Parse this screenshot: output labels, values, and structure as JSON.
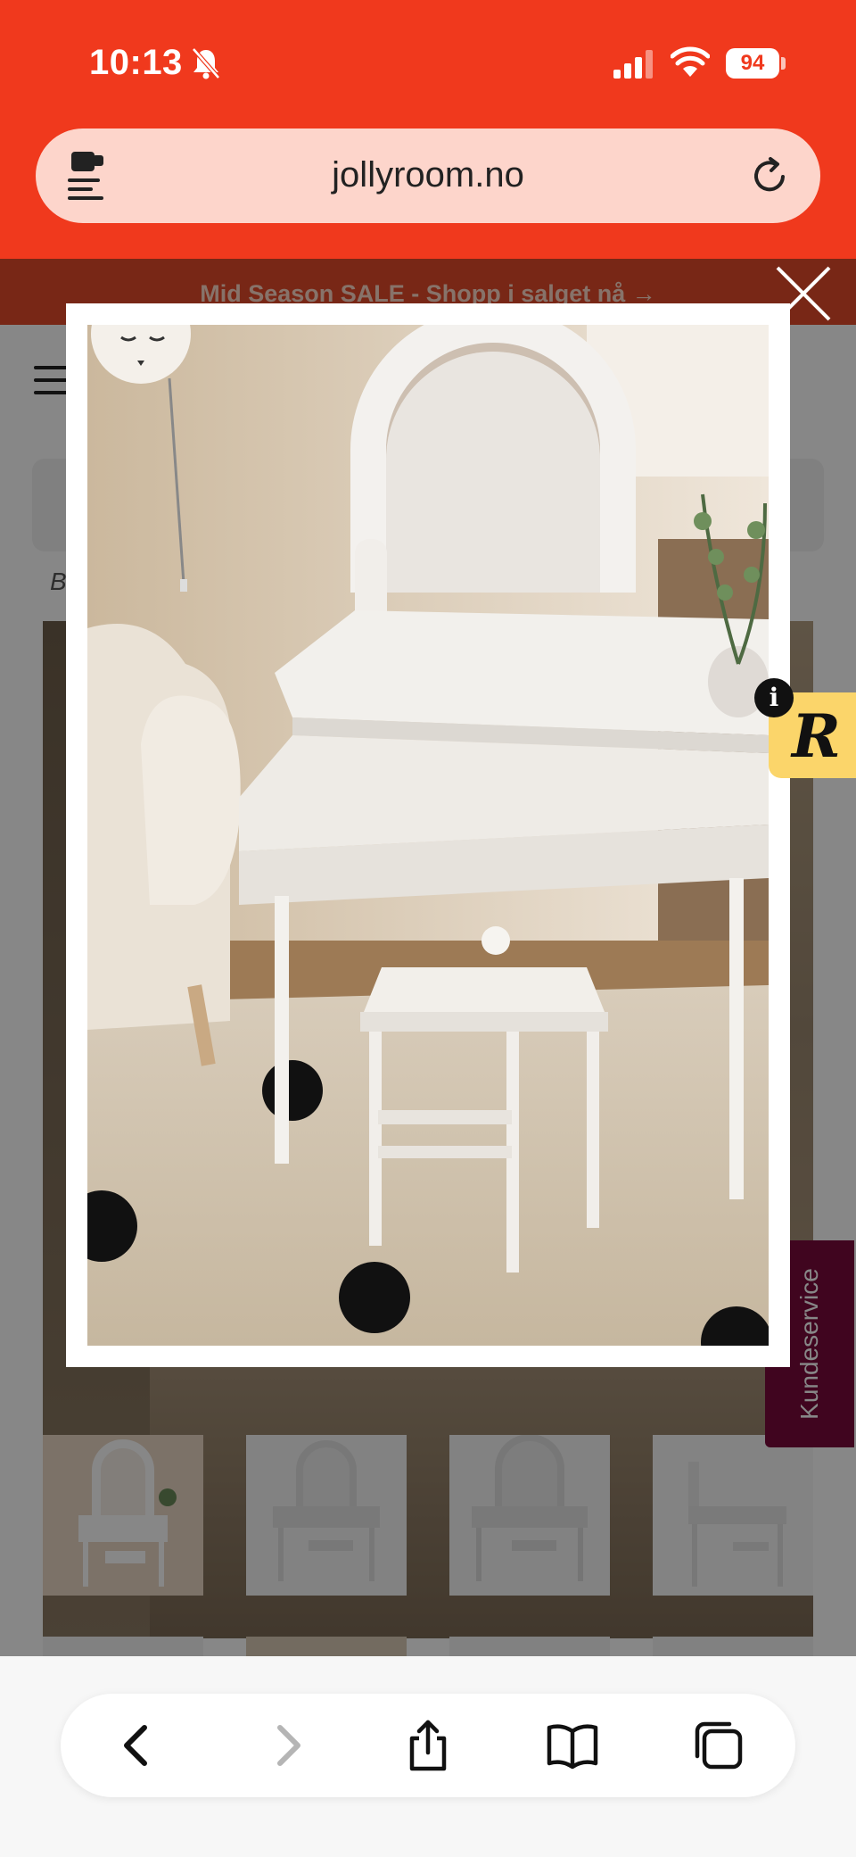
{
  "status_bar": {
    "time": "10:13",
    "battery": "94"
  },
  "browser": {
    "url": "jollyroom.no"
  },
  "page": {
    "promo_banner": "Mid Season SALE - Shopp i salget nå →",
    "breadcrumb": "B",
    "customer_service_tab": "Kundeservice"
  },
  "colors": {
    "status_bar_bg": "#f0391d",
    "url_bar_bg": "#fdd5cb",
    "promo_bg": "#e24a2b",
    "customer_service_bg": "#7a0b3c",
    "badge_bg": "#fbd56a"
  },
  "lightbox": {
    "close_icon": "close-icon",
    "image_subject": "white children's vanity table with arched mirror, drawer and stool"
  },
  "badge": {
    "letter": "R",
    "info": "i"
  },
  "toolbar": {
    "icons": [
      "back-icon",
      "forward-icon",
      "share-icon",
      "bookmarks-icon",
      "tabs-icon"
    ]
  }
}
